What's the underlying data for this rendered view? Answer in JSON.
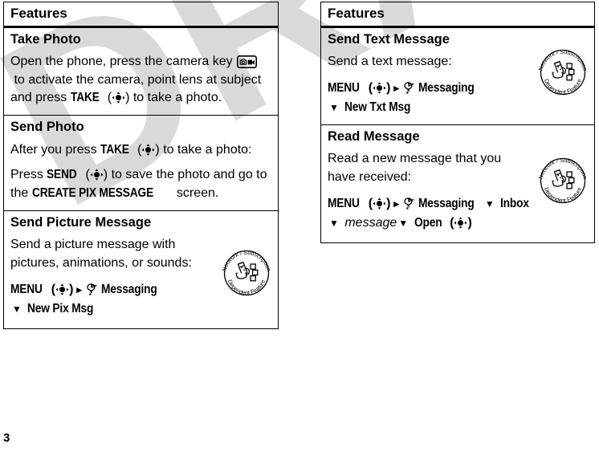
{
  "watermark": {
    "text": "DRAFT",
    "color": "#d9d9d9"
  },
  "footer": {
    "page_number": "3"
  },
  "left_table": {
    "header": "Features",
    "rows": [
      {
        "title": "Take Photo",
        "body_1_a": "Open the phone, press the camera key",
        "camera_key_icon": "camera-key-icon",
        "body_1_b": "to activate the camera, point lens at subject and press",
        "screen_label_1": "TAKE",
        "nav_key_icon": "navigation-key-icon",
        "body_1_c": "to take a photo."
      },
      {
        "title": "Send Photo",
        "body_1_a": "After you press",
        "screen_label_1": "TAKE",
        "body_1_b": "to take a photo:",
        "body_2_a": "Press",
        "screen_label_2": "SEND",
        "body_2_b": "to save the photo and go to the",
        "screen_label_3": "CREATE PIX MESSAGE",
        "body_2_c": "screen."
      },
      {
        "title": "Send Picture Message",
        "body_1": "Send a picture message with pictures, animations, or sounds:",
        "path": {
          "menu_label": "MENU",
          "arrow_right": "▸",
          "messaging_icon": "messaging-icon",
          "messaging_label": "Messaging",
          "arrow_down": "▼",
          "final_label": "New Pix Msg"
        },
        "stamp": {
          "top_text": "Network / Subscription",
          "bottom_text": "Dependent  Feature"
        }
      }
    ]
  },
  "right_table": {
    "header": "Features",
    "rows": [
      {
        "title": "Send Text Message",
        "body_1": "Send a text message:",
        "path": {
          "menu_label": "MENU",
          "arrow_right": "▸",
          "messaging_icon": "messaging-icon",
          "messaging_label": "Messaging",
          "arrow_down": "▼",
          "final_label": "New Txt Msg"
        },
        "stamp": {
          "top_text": "Network / Subscription",
          "bottom_text": "Dependent  Feature"
        }
      },
      {
        "title": "Read Message",
        "body_1": "Read a new message that you have received:",
        "path": {
          "menu_label": "MENU",
          "arrow_right": "▸",
          "messaging_icon": "messaging-icon",
          "messaging_label": "Messaging",
          "arrow_down_1": "▼",
          "inbox_label": "Inbox",
          "arrow_down_2": "▼",
          "message_label": "message",
          "arrow_down_3": "▼",
          "open_label": "Open"
        },
        "stamp": {
          "top_text": "Network / Subscription",
          "bottom_text": "Dependent  Feature"
        }
      }
    ]
  }
}
